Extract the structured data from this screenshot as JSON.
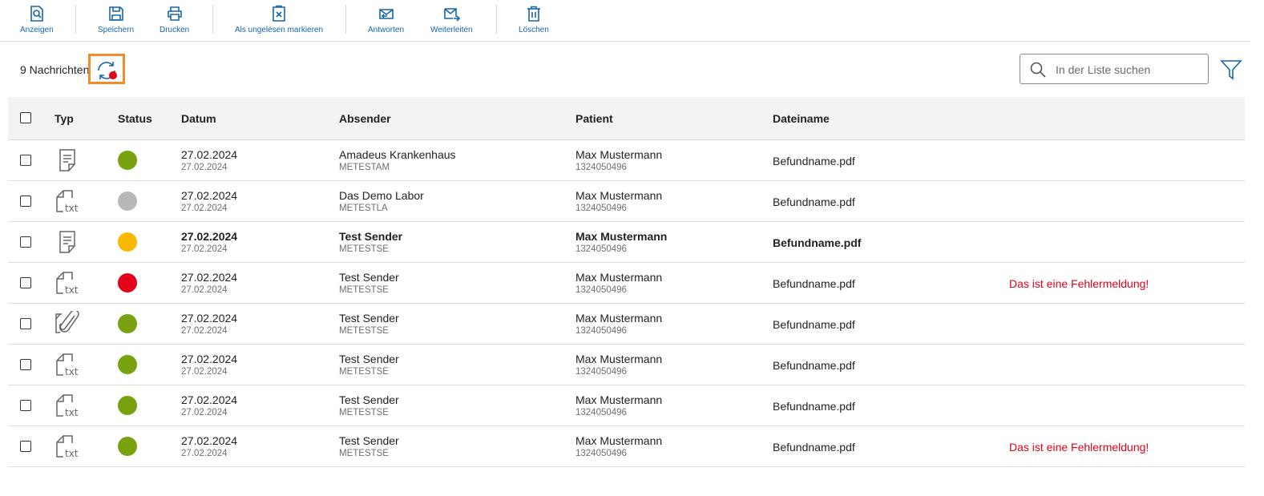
{
  "toolbar": {
    "view": "Anzeigen",
    "save": "Speichern",
    "print": "Drucken",
    "mark_unread": "Als ungelesen markieren",
    "reply": "Antworten",
    "forward": "Weiterleiten",
    "delete": "Löschen"
  },
  "list": {
    "count": "9 Nachrichten",
    "search_placeholder": "In der Liste suchen"
  },
  "columns": {
    "typ": "Typ",
    "status": "Status",
    "datum": "Datum",
    "absender": "Absender",
    "patient": "Patient",
    "dateiname": "Dateiname"
  },
  "colors": {
    "accent": "#1565a8",
    "highlight": "#f28c28",
    "error": "#e3001b",
    "status_ok": "#78a20e",
    "status_neutral": "#b8b8b8",
    "status_pending": "#fbb800",
    "status_error": "#e3001b"
  },
  "rows": [
    {
      "type_icon": "document-icon",
      "status": "ok",
      "date": "27.02.2024",
      "date_sub": "27.02.2024",
      "sender": "Amadeus Krankenhaus",
      "sender_id": "METESTAM",
      "patient": "Max Mustermann",
      "patient_id": "1324050496",
      "file": "Befundname.pdf",
      "error": "",
      "bold": false
    },
    {
      "type_icon": "txt-file-icon",
      "status": "neutral",
      "date": "27.02.2024",
      "date_sub": "27.02.2024",
      "sender": "Das Demo Labor",
      "sender_id": "METESTLA",
      "patient": "Max Mustermann",
      "patient_id": "1324050496",
      "file": "Befundname.pdf",
      "error": "",
      "bold": false
    },
    {
      "type_icon": "document-icon",
      "status": "pending",
      "date": "27.02.2024",
      "date_sub": "27.02.2024",
      "sender": "Test Sender",
      "sender_id": "METESTSE",
      "patient": "Max Mustermann",
      "patient_id": "1324050496",
      "file": "Befundname.pdf",
      "error": "",
      "bold": true
    },
    {
      "type_icon": "txt-file-icon",
      "status": "error",
      "date": "27.02.2024",
      "date_sub": "27.02.2024",
      "sender": "Test Sender",
      "sender_id": "METESTSE",
      "patient": "Max Mustermann",
      "patient_id": "1324050496",
      "file": "Befundname.pdf",
      "error": "Das ist eine Fehlermeldung!",
      "bold": false
    },
    {
      "type_icon": "attachment-icon",
      "status": "ok",
      "date": "27.02.2024",
      "date_sub": "27.02.2024",
      "sender": "Test Sender",
      "sender_id": "METESTSE",
      "patient": "Max Mustermann",
      "patient_id": "1324050496",
      "file": "Befundname.pdf",
      "error": "",
      "bold": false
    },
    {
      "type_icon": "txt-file-icon",
      "status": "ok",
      "date": "27.02.2024",
      "date_sub": "27.02.2024",
      "sender": "Test Sender",
      "sender_id": "METESTSE",
      "patient": "Max Mustermann",
      "patient_id": "1324050496",
      "file": "Befundname.pdf",
      "error": "",
      "bold": false
    },
    {
      "type_icon": "txt-file-icon",
      "status": "ok",
      "date": "27.02.2024",
      "date_sub": "27.02.2024",
      "sender": "Test Sender",
      "sender_id": "METESTSE",
      "patient": "Max Mustermann",
      "patient_id": "1324050496",
      "file": "Befundname.pdf",
      "error": "",
      "bold": false
    },
    {
      "type_icon": "txt-file-icon",
      "status": "ok",
      "date": "27.02.2024",
      "date_sub": "27.02.2024",
      "sender": "Test Sender",
      "sender_id": "METESTSE",
      "patient": "Max Mustermann",
      "patient_id": "1324050496",
      "file": "Befundname.pdf",
      "error": "Das ist eine Fehlermeldung!",
      "bold": false
    }
  ]
}
